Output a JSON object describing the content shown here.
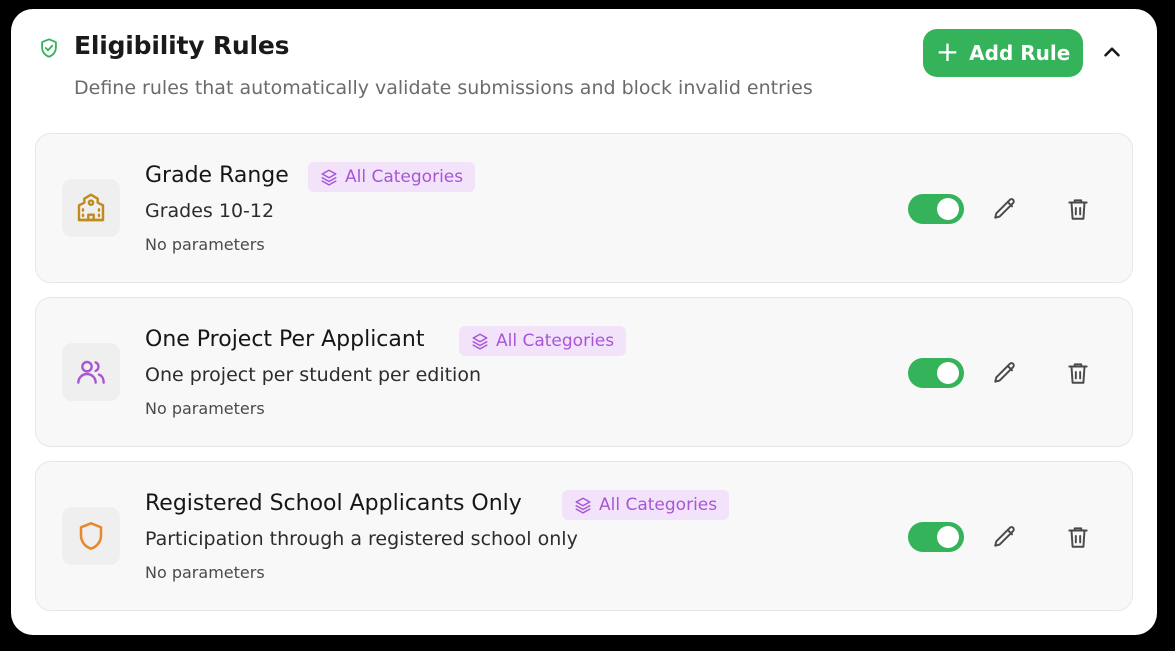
{
  "header": {
    "title": "Eligibility Rules",
    "subtitle": "Define rules that automatically validate submissions and block invalid entries",
    "add_button_label": "Add Rule",
    "add_button_icon": "plus-icon",
    "collapse_icon": "chevron-up-icon",
    "header_icon": "shield-check-icon"
  },
  "colors": {
    "accent_green": "#34b35a",
    "badge_bg": "#f2e3fb",
    "badge_text": "#a855d6",
    "school_icon": "#c08a1e",
    "users_icon": "#a855d6",
    "shield_icon": "#e8872e"
  },
  "rules": [
    {
      "name": "Grade Range",
      "badge": "All Categories",
      "description": "Grades 10-12",
      "params": "No parameters",
      "icon": "school-icon",
      "enabled": true
    },
    {
      "name": "One Project Per Applicant",
      "badge": "All Categories",
      "description": "One project per student per edition",
      "params": "No parameters",
      "icon": "users-icon",
      "enabled": true
    },
    {
      "name": "Registered School Applicants Only",
      "badge": "All Categories",
      "description": "Participation through a registered school only",
      "params": "No parameters",
      "icon": "shield-icon",
      "enabled": true
    }
  ]
}
